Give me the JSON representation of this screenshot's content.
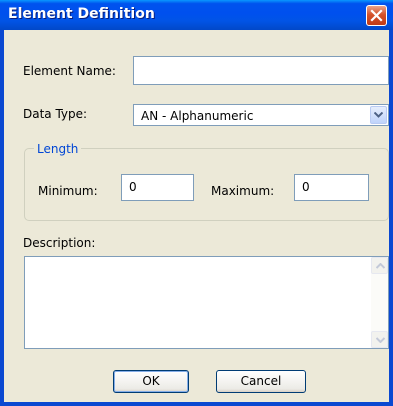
{
  "window": {
    "title": "Element Definition"
  },
  "form": {
    "element_name_label": "Element Name:",
    "element_name_value": "",
    "data_type_label": "Data Type:",
    "data_type_selected": "AN - Alphanumeric",
    "length_group_label": "Length",
    "minimum_label": "Minimum:",
    "minimum_value": "0",
    "maximum_label": "Maximum:",
    "maximum_value": "0",
    "description_label": "Description:",
    "description_value": ""
  },
  "buttons": {
    "ok_label": "OK",
    "cancel_label": "Cancel"
  },
  "colors": {
    "titlebar": "#0054e3",
    "face": "#ece9d8",
    "group_label": "#0046d5",
    "close": "#d5532b"
  },
  "icons": {
    "close": "close-x-icon",
    "dropdown": "chevron-down-icon",
    "scroll_up": "arrow-up-icon",
    "scroll_down": "arrow-down-icon"
  }
}
